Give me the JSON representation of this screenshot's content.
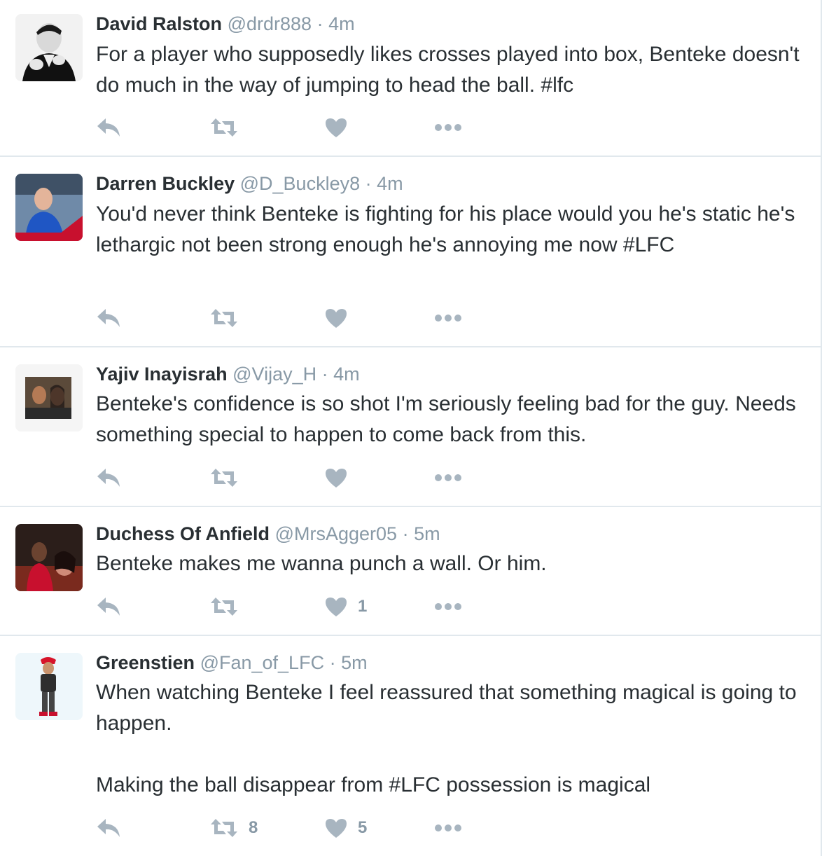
{
  "tweets": [
    {
      "name": "David Ralston",
      "handle": "@drdr888",
      "separator": "·",
      "time": "4m",
      "text": "For a player who supposedly likes crosses played into box, Benteke doesn't do much in the way of jumping to head the ball. #lfc",
      "retweets": "",
      "likes": ""
    },
    {
      "name": "Darren Buckley",
      "handle": "@D_Buckley8",
      "separator": "·",
      "time": "4m",
      "text": "You'd never think Benteke is fighting for his place would you he's static he's lethargic not been strong enough he's annoying me now #LFC",
      "retweets": "",
      "likes": ""
    },
    {
      "name": "Yajiv Inayisrah",
      "handle": "@Vijay_H",
      "separator": "·",
      "time": "4m",
      "text": "Benteke's confidence is so shot I'm seriously feeling bad for the guy. Needs something special to happen to come back from this.",
      "retweets": "",
      "likes": ""
    },
    {
      "name": "Duchess Of Anfield",
      "handle": "@MrsAgger05",
      "separator": "·",
      "time": "5m",
      "text": "Benteke makes me wanna punch a wall. Or him.",
      "retweets": "",
      "likes": "1"
    },
    {
      "name": "Greenstien",
      "handle": "@Fan_of_LFC",
      "separator": "·",
      "time": "5m",
      "text": "When watching Benteke I feel reassured that something magical is going to happen.\n\nMaking the ball disappear from #LFC possession is magical",
      "retweets": "8",
      "likes": "5"
    }
  ],
  "colors": {
    "text": "#292f33",
    "muted": "#8899a6",
    "icon": "#a8b5c0",
    "divider": "#e1e8ed"
  },
  "icons": [
    "reply-icon",
    "retweet-icon",
    "heart-icon",
    "more-icon"
  ]
}
